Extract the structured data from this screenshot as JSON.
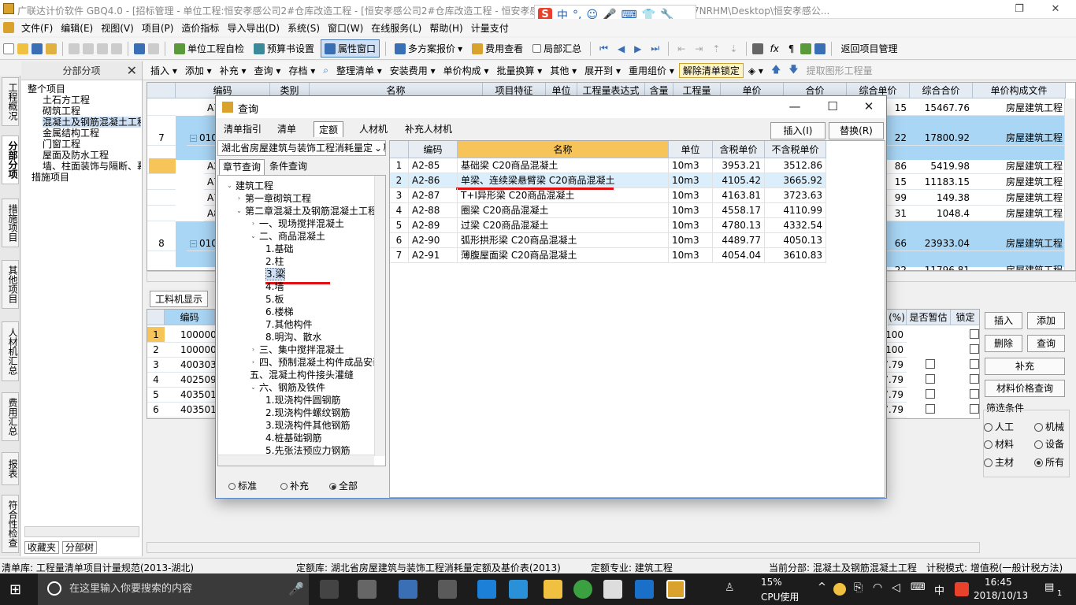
{
  "window": {
    "title": "广联达计价软件 GBQ4.0 - [招标管理 - 单位工程:恒安孝感公司2#仓库改造工程 - [恒安孝感公司2#仓库改造工程 - 恒安孝感公... s\\Administrator.PC-20141127NRHM\\Desktop\\恒安孝感公..."
  },
  "ime": {
    "logo": "S",
    "items": [
      "中",
      "°,",
      "☺",
      "🎤",
      "⌨",
      "👕",
      "🔧"
    ]
  },
  "menu": [
    "文件(F)",
    "编辑(E)",
    "视图(V)",
    "项目(P)",
    "造价指标",
    "导入导出(D)",
    "系统(S)",
    "窗口(W)",
    "在线服务(L)",
    "帮助(H)",
    "计量支付"
  ],
  "toolbar1": {
    "unit_check": "单位工程自检",
    "budget_settings": "预算书设置",
    "property_window": "属性窗口",
    "multi_plan": "多方案报价",
    "fee_view": "费用查看",
    "local_summary": "局部汇总",
    "return_project": "返回项目管理"
  },
  "nav": {
    "header": "分部分项",
    "close": "✕",
    "items": [
      "整个项目",
      "土石方工程",
      "砌筑工程",
      "混凝土及钢筋混凝土工程",
      "金属结构工程",
      "门窗工程",
      "屋面及防水工程",
      "墙、柱面装饰与隔断、幕墙工程",
      "措施项目"
    ],
    "bottom_tabs": [
      "收藏夹",
      "分部树"
    ]
  },
  "left_tabs": [
    "工程概况",
    "分部分项",
    "措施项目",
    "其他项目",
    "人材机汇总",
    "费用汇总",
    "报表",
    "符合性检查"
  ],
  "toolbar2": [
    "插入 ▾",
    "添加 ▾",
    "补充 ▾",
    "查询 ▾",
    "存档 ▾",
    "整理清单 ▾",
    "安装费用 ▾",
    "单价构成 ▾",
    "批量换算 ▾",
    "其他 ▾",
    "展开到 ▾",
    "重用组价 ▾",
    "解除清单锁定",
    "提取图形工程量"
  ],
  "grid": {
    "headers": [
      "编码",
      "类别",
      "名称",
      "项目特征",
      "单位",
      "工程量表达式",
      "含量",
      "工程量",
      "单价",
      "合价",
      "综合单价",
      "综合合价",
      "单价构成文件"
    ],
    "rows": [
      {
        "no": "",
        "code": "A7",
        "unit_price": "15",
        "total": "15467.76",
        "file": "房屋建筑工程"
      },
      {
        "no": "7",
        "code": "010",
        "unit_price": "22",
        "total": "17800.92",
        "file": "房屋建筑工程"
      },
      {
        "no": "",
        "code": "A2",
        "unit_price": "86",
        "total": "5419.98",
        "file": "房屋建筑工程"
      },
      {
        "no": "",
        "code": "A7",
        "unit_price": "15",
        "total": "11183.15",
        "file": "房屋建筑工程"
      },
      {
        "no": "",
        "code": "A7",
        "unit_price": "99",
        "total": "149.38",
        "file": "房屋建筑工程"
      },
      {
        "no": "",
        "code": "A8",
        "unit_price": "31",
        "total": "1048.4",
        "file": "房屋建筑工程"
      },
      {
        "no": "8",
        "code": "010",
        "unit_price": "66",
        "total": "23933.04",
        "file": "房屋建筑工程"
      },
      {
        "no": "",
        "code": "",
        "unit_price": "22",
        "total": "11796.81",
        "file": "房屋建筑工程"
      }
    ]
  },
  "lower": {
    "tab": "工料机显示",
    "code_header": "编码",
    "headers_right": [
      "(%)",
      "是否暂估",
      "锁定"
    ],
    "rows": [
      {
        "no": "1",
        "code": "1000000",
        "pct": "100"
      },
      {
        "no": "2",
        "code": "1000000",
        "pct": "100"
      },
      {
        "no": "3",
        "code": "4003035",
        "pct": "7.79"
      },
      {
        "no": "4",
        "code": "4025090",
        "pct": "7.79"
      },
      {
        "no": "5",
        "code": "4035010",
        "pct": "7.79"
      },
      {
        "no": "6",
        "code": "4035011",
        "pct": "7.79"
      }
    ]
  },
  "right_panel": {
    "insert": "插入",
    "add": "添加",
    "delete": "删除",
    "query": "查询",
    "supplement": "补充",
    "price_query": "材料价格查询",
    "filter_title": "筛选条件",
    "filters": [
      {
        "label": "人工",
        "on": false
      },
      {
        "label": "机械",
        "on": false
      },
      {
        "label": "材料",
        "on": false
      },
      {
        "label": "设备",
        "on": false
      },
      {
        "label": "主材",
        "on": false
      },
      {
        "label": "所有",
        "on": true
      }
    ]
  },
  "dialog": {
    "title": "查询",
    "tabs": [
      "清单指引",
      "清单",
      "定额",
      "人材机",
      "补充人材机"
    ],
    "insert_btn": "插入(I)",
    "replace_btn": "替换(R)",
    "library": "湖北省房屋建筑与装饰工程消耗量定额及基价表(2013)",
    "search_tabs": [
      "章节查询",
      "条件查询"
    ],
    "tree": [
      {
        "label": "建筑工程",
        "level": 0,
        "exp": "-"
      },
      {
        "label": "第一章砌筑工程",
        "level": 1,
        "exp": "›"
      },
      {
        "label": "第二章混凝土及钢筋混凝土工程",
        "level": 1,
        "exp": "-"
      },
      {
        "label": "一、现场搅拌混凝土",
        "level": 2,
        "exp": "›"
      },
      {
        "label": "二、商品混凝土",
        "level": 2,
        "exp": "-"
      },
      {
        "label": "1.基础",
        "level": 3,
        "exp": ""
      },
      {
        "label": "2.柱",
        "level": 3,
        "exp": ""
      },
      {
        "label": "3.梁",
        "level": 3,
        "exp": "",
        "sel": true
      },
      {
        "label": "4.墙",
        "level": 3,
        "exp": ""
      },
      {
        "label": "5.板",
        "level": 3,
        "exp": ""
      },
      {
        "label": "6.楼梯",
        "level": 3,
        "exp": ""
      },
      {
        "label": "7.其他构件",
        "level": 3,
        "exp": ""
      },
      {
        "label": "8.明沟、散水",
        "level": 3,
        "exp": ""
      },
      {
        "label": "三、集中搅拌混凝土",
        "level": 2,
        "exp": "›"
      },
      {
        "label": "四、预制混凝土构件成品安装",
        "level": 2,
        "exp": "›"
      },
      {
        "label": "五、混凝土构件接头灌缝",
        "level": 2,
        "exp": ""
      },
      {
        "label": "六、钢筋及铁件",
        "level": 2,
        "exp": "-"
      },
      {
        "label": "1.现浇构件圆钢筋",
        "level": 3,
        "exp": ""
      },
      {
        "label": "2.现浇构件螺纹钢筋",
        "level": 3,
        "exp": ""
      },
      {
        "label": "3.现浇构件其他钢筋",
        "level": 3,
        "exp": ""
      },
      {
        "label": "4.桩基础钢筋",
        "level": 3,
        "exp": ""
      },
      {
        "label": "5.先张法预应力钢筋",
        "level": 3,
        "exp": ""
      }
    ],
    "filter_options": [
      {
        "label": "标准",
        "on": false
      },
      {
        "label": "补充",
        "on": false
      },
      {
        "label": "全部",
        "on": true
      }
    ],
    "table_headers": [
      "编码",
      "名称",
      "单位",
      "含税单价",
      "不含税单价"
    ],
    "table_rows": [
      {
        "no": "1",
        "code": "A2-85",
        "name": "基础梁 C20商品混凝土",
        "unit": "10m3",
        "tax_price": "3953.21",
        "notax_price": "3512.86"
      },
      {
        "no": "2",
        "code": "A2-86",
        "name": "单梁、连续梁悬臂梁 C20商品混凝土",
        "unit": "10m3",
        "tax_price": "4105.42",
        "notax_price": "3665.92"
      },
      {
        "no": "3",
        "code": "A2-87",
        "name": "T+I异形梁 C20商品混凝土",
        "unit": "10m3",
        "tax_price": "4163.81",
        "notax_price": "3723.63"
      },
      {
        "no": "4",
        "code": "A2-88",
        "name": "圈梁 C20商品混凝土",
        "unit": "10m3",
        "tax_price": "4558.17",
        "notax_price": "4110.99"
      },
      {
        "no": "5",
        "code": "A2-89",
        "name": "过梁 C20商品混凝土",
        "unit": "10m3",
        "tax_price": "4780.13",
        "notax_price": "4332.54"
      },
      {
        "no": "6",
        "code": "A2-90",
        "name": "弧形拱形梁 C20商品混凝土",
        "unit": "10m3",
        "tax_price": "4489.77",
        "notax_price": "4050.13"
      },
      {
        "no": "7",
        "code": "A2-91",
        "name": "薄腹屋面梁 C20商品混凝土",
        "unit": "10m3",
        "tax_price": "4054.04",
        "notax_price": "3610.83"
      }
    ]
  },
  "status": {
    "list_lib": "清单库: 工程量清单项目计量规范(2013-湖北)",
    "quota_lib": "定额库: 湖北省房屋建筑与装饰工程消耗量定额及基价表(2013)",
    "quota_major": "定额专业: 建筑工程",
    "current": "当前分部: 混凝土及钢筋混凝土工程",
    "mode": "计税模式: 增值税(一般计税方法)"
  },
  "taskbar": {
    "search_placeholder": "在这里输入你要搜索的内容",
    "cpu_pct": "15%",
    "cpu_label": "CPU使用",
    "time": "16:45",
    "date": "2018/10/13",
    "lang": "中",
    "notify": "1"
  },
  "colors": {
    "selection": "#a9d6f5",
    "header_sel": "#f7c45a",
    "annotation": "#e01010"
  }
}
